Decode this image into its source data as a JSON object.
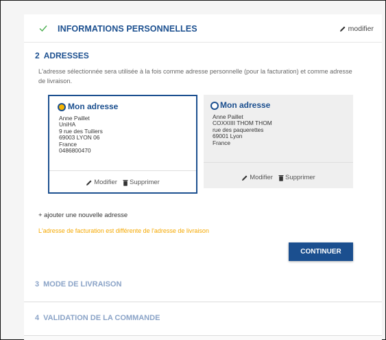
{
  "step1": {
    "title": "INFORMATIONS PERSONNELLES",
    "edit_label": "modifier"
  },
  "step2": {
    "number": "2",
    "title": "ADRESSES",
    "description": "L'adresse sélectionnée sera utilisée à la fois comme adresse personnelle (pour la facturation) et comme adresse de livraison.",
    "addresses": [
      {
        "title": "Mon adresse",
        "selected": true,
        "lines": [
          "Anne Paillet",
          "UniHA",
          "9 rue des Tuiliers",
          "69003 LYON 06",
          "France",
          "0486800470"
        ],
        "edit_label": "Modifier",
        "delete_label": "Supprimer"
      },
      {
        "title": "Mon adresse",
        "selected": false,
        "lines": [
          "Anne Paillet",
          "COXXIIII THOM THOM",
          "rue des paquerettes",
          "69001 Lyon",
          "France"
        ],
        "edit_label": "Modifier",
        "delete_label": "Supprimer"
      }
    ],
    "add_address_label": "+ ajouter une nouvelle adresse",
    "warning": "L'adresse de facturation est différente de l'adresse de livraison",
    "continue_label": "CONTINUER"
  },
  "step3": {
    "number": "3",
    "title": "MODE DE LIVRAISON"
  },
  "step4": {
    "number": "4",
    "title": "VALIDATION DE LA COMMANDE"
  },
  "colors": {
    "primary": "#1b4f8f",
    "warning": "#f5a800",
    "check": "#4caf50",
    "muted_step": "#8aa3c7"
  }
}
